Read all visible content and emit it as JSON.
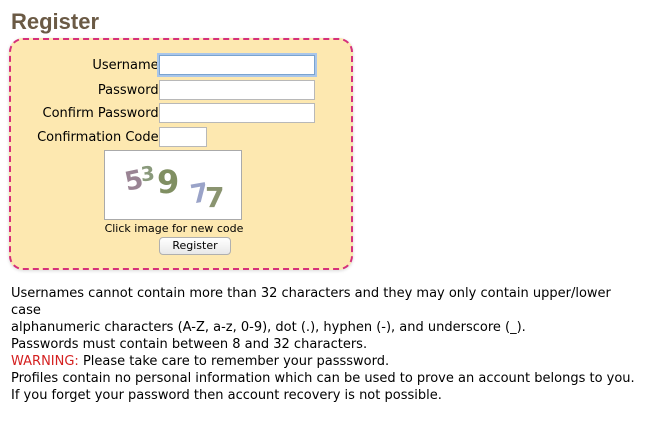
{
  "page": {
    "title": "Register"
  },
  "form": {
    "username_label": "Username:",
    "username_value": "",
    "password_label": "Password:",
    "password_value": "",
    "confirm_label": "Confirm Password:",
    "confirm_value": "",
    "code_label": "Confirmation Code:",
    "code_value": "",
    "captcha_text": "539 7",
    "captcha_hint": "Click image for new code",
    "submit_label": "Register"
  },
  "info": {
    "line1": "Usernames cannot contain more than 32 characters and they may only contain upper/lower case",
    "line2": "alphanumeric characters (A-Z, a-z, 0-9), dot (.), hyphen (-), and underscore (_).",
    "line3": "Passwords must contain between 8 and 32 characters."
  },
  "warning": {
    "label": "WARNING:",
    "line1": " Please take care to remember your passsword.",
    "line2": "Profiles contain no personal information which can be used to prove an account belongs to you.",
    "line3": "If you forget your password then account recovery is not possible."
  },
  "colors": {
    "title": "#6b5a45",
    "box_background": "#fde8b0",
    "box_border": "#d6307a",
    "warning": "#d42020"
  }
}
